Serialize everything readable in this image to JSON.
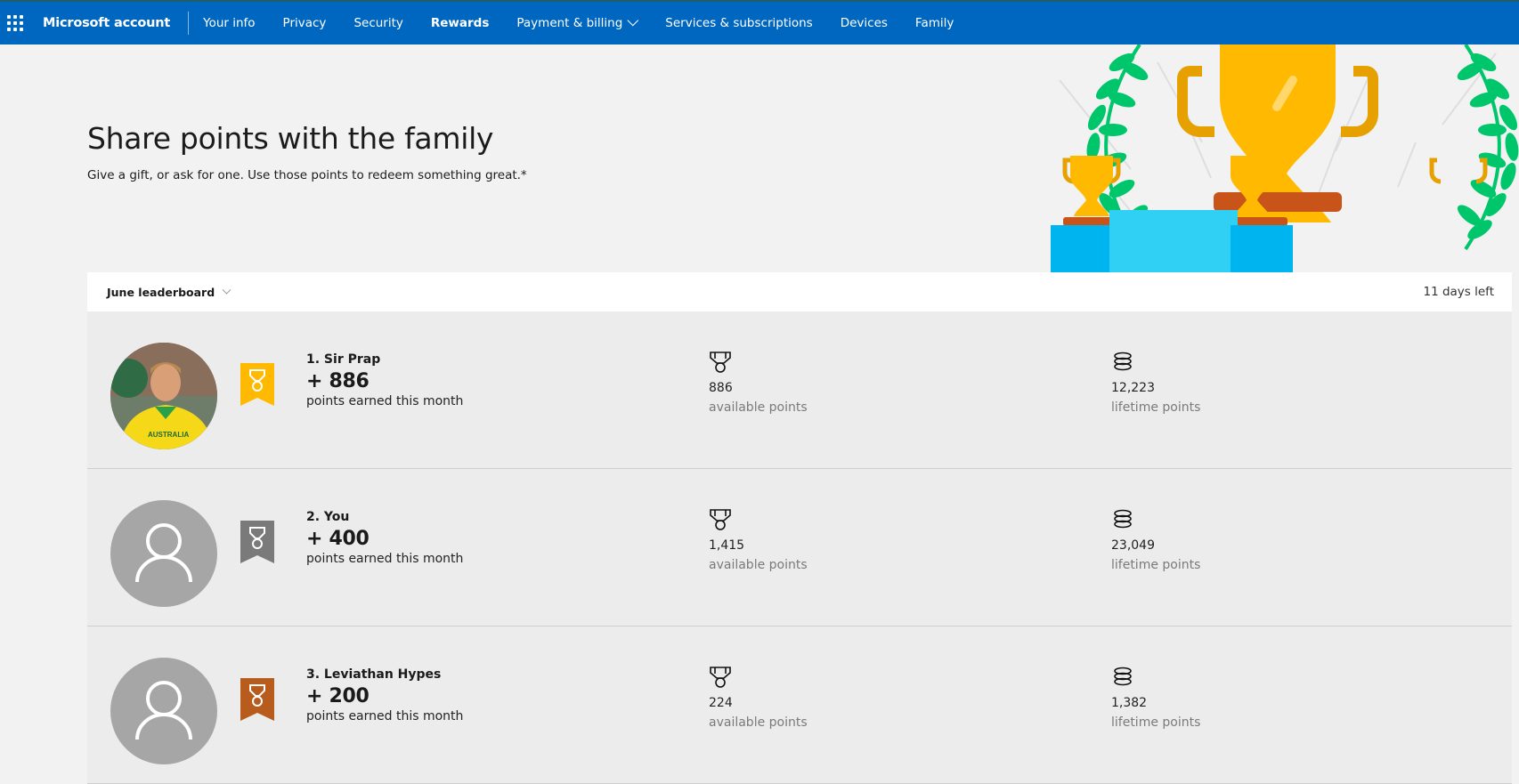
{
  "nav": {
    "brand": "Microsoft account",
    "items": [
      {
        "label": "Your info",
        "active": false
      },
      {
        "label": "Privacy",
        "active": false
      },
      {
        "label": "Security",
        "active": false
      },
      {
        "label": "Rewards",
        "active": true
      },
      {
        "label": "Payment & billing",
        "active": false,
        "dropdown": true
      },
      {
        "label": "Services & subscriptions",
        "active": false
      },
      {
        "label": "Devices",
        "active": false
      },
      {
        "label": "Family",
        "active": false
      }
    ]
  },
  "hero": {
    "title": "Share points with the family",
    "subtitle": "Give a gift, or ask for one. Use those points to redeem something great.*",
    "illustration": "trophy-podium-illustration"
  },
  "leaderboard": {
    "selected_period": "June leaderboard",
    "days_left": "11 days left",
    "rows": [
      {
        "rank_name": "1. Sir Prap",
        "earned": "+ 886",
        "earned_label": "points earned this month",
        "available": "886",
        "available_label": "available points",
        "lifetime": "12,223",
        "lifetime_label": "lifetime points",
        "medal": "gold",
        "medal_color": "#ffb900",
        "avatar": "photo"
      },
      {
        "rank_name": "2. You",
        "earned": "+ 400",
        "earned_label": "points earned this month",
        "available": "1,415",
        "available_label": "available points",
        "lifetime": "23,049",
        "lifetime_label": "lifetime points",
        "medal": "silver",
        "medal_color": "#7a7a7a",
        "avatar": "default"
      },
      {
        "rank_name": "3. Leviathan Hypes",
        "earned": "+ 200",
        "earned_label": "points earned this month",
        "available": "224",
        "available_label": "available points",
        "lifetime": "1,382",
        "lifetime_label": "lifetime points",
        "medal": "bronze",
        "medal_color": "#b85c1e",
        "avatar": "default"
      }
    ]
  },
  "colors": {
    "nav_bg": "#0067c0",
    "page_bg": "#f2f2f2",
    "row_bg": "#ececec",
    "avatar_bg": "#a6a6a6"
  }
}
